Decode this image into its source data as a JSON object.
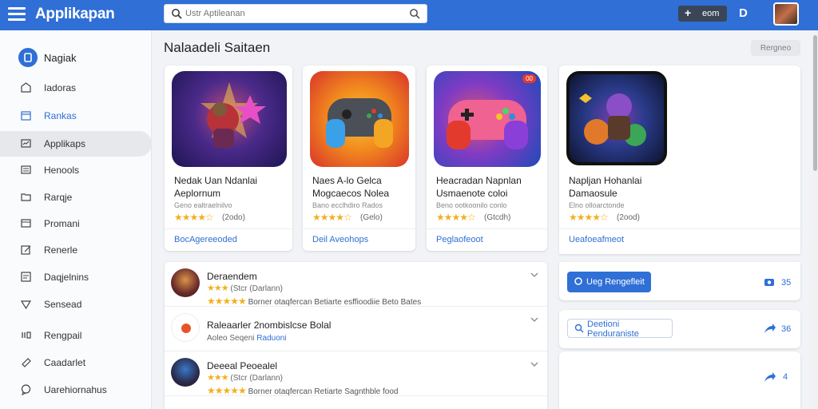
{
  "app": {
    "title": "Applikapan"
  },
  "search": {
    "placeholder": "Ustr Aptileanan"
  },
  "header": {
    "add_label": "eom",
    "d_label": "D"
  },
  "sidebar": {
    "items": [
      {
        "label": "Nagiak",
        "icon": "home-icon"
      },
      {
        "label": "Iadoras",
        "icon": "upload-icon"
      },
      {
        "label": "Rankas",
        "icon": "calendar-icon"
      },
      {
        "label": "Applikaps",
        "icon": "apps-icon"
      },
      {
        "label": "Henools",
        "icon": "list-icon"
      },
      {
        "label": "Rarqje",
        "icon": "folder-icon"
      },
      {
        "label": "Promani",
        "icon": "window-icon"
      },
      {
        "label": "Renerle",
        "icon": "edit-icon"
      },
      {
        "label": "Daqjelnins",
        "icon": "doc-icon"
      },
      {
        "label": "Sensead",
        "icon": "heart-icon"
      },
      {
        "label": "Rengpail",
        "icon": "code-icon"
      },
      {
        "label": "Caadarlet",
        "icon": "link-icon"
      },
      {
        "label": "Uarehiornahus",
        "icon": "chat-icon"
      }
    ]
  },
  "main": {
    "title": "Nalaadeli Saitaen",
    "header_button": "Rergneo"
  },
  "cards": [
    {
      "line1": "Nedak Uan Ndanlai",
      "line2": "Aeplornum",
      "line3": "Geno ealtraelnilvo",
      "stars": "★★★★☆",
      "rating": "(2odo)",
      "link": "BocAgereeoded",
      "colors": "accent"
    },
    {
      "line1": "Naes A-lo Gelca",
      "line2": "Mogcaecos Nolea",
      "line3": "Bano ecclhdiro Rados",
      "stars": "★★★★☆",
      "rating": "(Gelo)",
      "link": "Deil Aveohops"
    },
    {
      "line1": "Heacradan Napnlan",
      "line2": "Usmaenote coloi",
      "line3": "Beno ootkoonilo conlo",
      "stars": "★★★★☆",
      "rating": "(Gtcdh)",
      "link": "Peglaofeoot",
      "badge": "00"
    },
    {
      "line1": "Napljan Hohanlai",
      "line2": "Damaosule",
      "line3": "Elno olloarctonde",
      "stars": "★★★★☆",
      "rating": "(2ood)",
      "link": "Ueafoeafmeot"
    }
  ],
  "list": [
    {
      "title": "Deraendem",
      "stars": "★★★",
      "sub": "(Stcr (Darlann)",
      "stars2": "★★★★★",
      "desc": "Borner otaqfercan Betiarte esffioodiie Beto Bates"
    },
    {
      "title": "Raleaarler 2nombislcse Bolal",
      "sub": "Aoleo Seqeni",
      "sub_link": "Raduoni"
    },
    {
      "title": "Deeeal Peoealel",
      "stars": "★★★",
      "sub": "(Stcr (Darlann)",
      "stars2": "★★★★★",
      "desc": "Borner otaqfercan Retiarte Sagnthble food"
    }
  ],
  "right": {
    "primary_button": "Ueg Rengefleit",
    "primary_count": "35",
    "outline_button": "Deetioni Penduraniste",
    "outline_count": "36",
    "bottom_count": "4"
  }
}
